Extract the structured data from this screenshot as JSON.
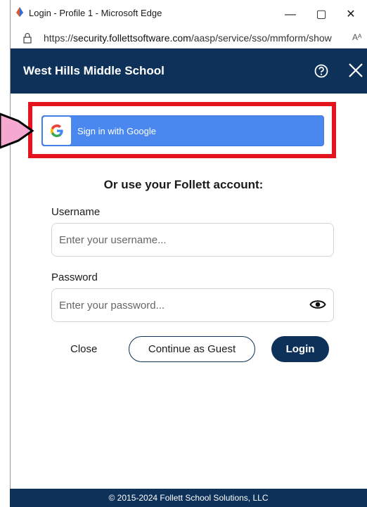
{
  "window": {
    "title": "Login - Profile 1 - Microsoft Edge",
    "minimize": "—",
    "maximize": "▢",
    "close": "✕"
  },
  "address": {
    "prefix": "https://",
    "domain": "security.follettsoftware.com",
    "path": "/aasp/service/sso/mmform/show",
    "read_aloud": "Aᴬ"
  },
  "header": {
    "school_name": "West Hills Middle School"
  },
  "google": {
    "label": "Sign in with Google"
  },
  "form": {
    "or_title": "Or use your Follett account:",
    "username_label": "Username",
    "username_placeholder": "Enter your username...",
    "password_label": "Password",
    "password_placeholder": "Enter your password..."
  },
  "actions": {
    "close": "Close",
    "guest": "Continue as Guest",
    "login": "Login"
  },
  "footer": {
    "copyright": "© 2015-2024 Follett School Solutions, LLC"
  },
  "colors": {
    "header_bg": "#0d3159",
    "google_blue": "#4a87ee",
    "highlight_red": "#e3141c",
    "annotation_pink": "#f5a9d0"
  }
}
